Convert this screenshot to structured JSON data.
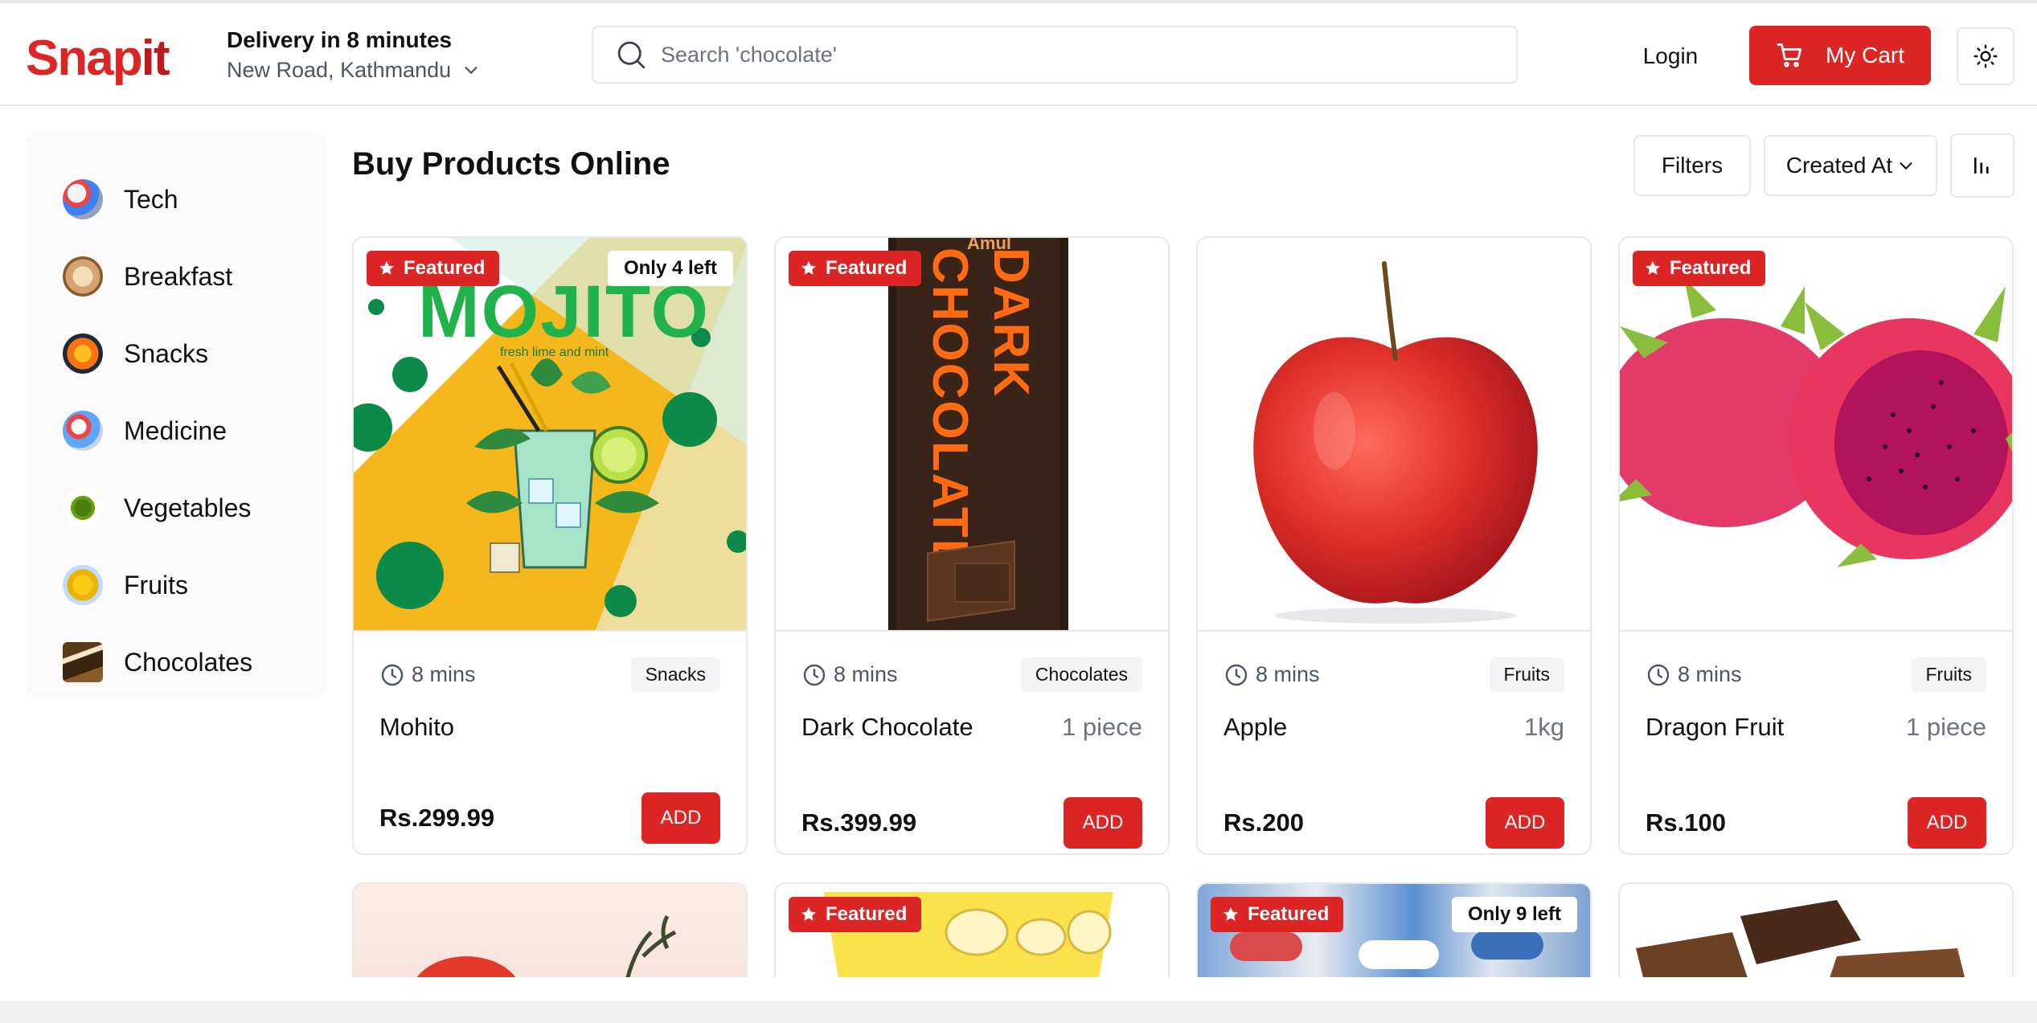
{
  "header": {
    "logo_part1": "Snap",
    "logo_part2": "it",
    "delivery_title": "Delivery in 8 minutes",
    "delivery_location": "New Road, Kathmandu",
    "search_placeholder": "Search 'chocolate'",
    "login_label": "Login",
    "cart_label": "My Cart"
  },
  "sidebar": {
    "items": [
      {
        "label": "Tech",
        "icon": "tech-icon"
      },
      {
        "label": "Breakfast",
        "icon": "breakfast-icon"
      },
      {
        "label": "Snacks",
        "icon": "snacks-icon"
      },
      {
        "label": "Medicine",
        "icon": "medicine-icon"
      },
      {
        "label": "Vegetables",
        "icon": "vegetables-icon"
      },
      {
        "label": "Fruits",
        "icon": "fruits-icon"
      },
      {
        "label": "Chocolates",
        "icon": "chocolates-icon"
      }
    ]
  },
  "main": {
    "title": "Buy Products Online",
    "filters_label": "Filters",
    "sort_label": "Created At"
  },
  "products": [
    {
      "name": "Mohito",
      "time": "8 mins",
      "category": "Snacks",
      "unit": "",
      "price": "Rs.299.99",
      "featured": "Featured",
      "stock": "Only 4 left",
      "add": "ADD"
    },
    {
      "name": "Dark Chocolate",
      "time": "8 mins",
      "category": "Chocolates",
      "unit": "1 piece",
      "price": "Rs.399.99",
      "featured": "Featured",
      "stock": "",
      "add": "ADD"
    },
    {
      "name": "Apple",
      "time": "8 mins",
      "category": "Fruits",
      "unit": "1kg",
      "price": "Rs.200",
      "featured": "",
      "stock": "",
      "add": "ADD"
    },
    {
      "name": "Dragon Fruit",
      "time": "8 mins",
      "category": "Fruits",
      "unit": "1 piece",
      "price": "Rs.100",
      "featured": "Featured",
      "stock": "",
      "add": "ADD"
    }
  ],
  "products_row2": [
    {
      "featured": "",
      "stock": ""
    },
    {
      "featured": "Featured",
      "stock": ""
    },
    {
      "featured": "Featured",
      "stock": "Only 9 left"
    },
    {
      "featured": "",
      "stock": ""
    }
  ],
  "image_text": {
    "mojito_title": "MOJITO",
    "mojito_sub": "fresh lime and mint",
    "choco_brand": "Amul",
    "choco_title": "DARK CHOCOLATE"
  },
  "colors": {
    "accent": "#dc2626",
    "border": "#e5e7eb",
    "muted": "#6b7280"
  }
}
